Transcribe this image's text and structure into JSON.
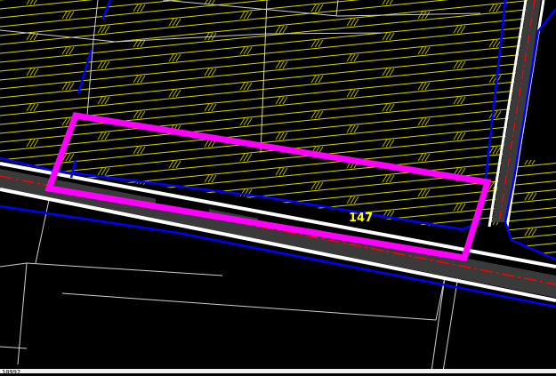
{
  "map": {
    "parcel_label": "147",
    "status_text": "10992",
    "colors": {
      "background": "#000000",
      "hatch": "#d8d800",
      "hatch_marks": "#b0b000",
      "boundary": "#0000ff",
      "selection": "#ff00ff",
      "road_edge": "#ffffff",
      "road_fill": "#3a3a3a",
      "centerline": "#ff0000",
      "parcel_lines": "#cfcfcf",
      "label": "#ffff00"
    }
  }
}
